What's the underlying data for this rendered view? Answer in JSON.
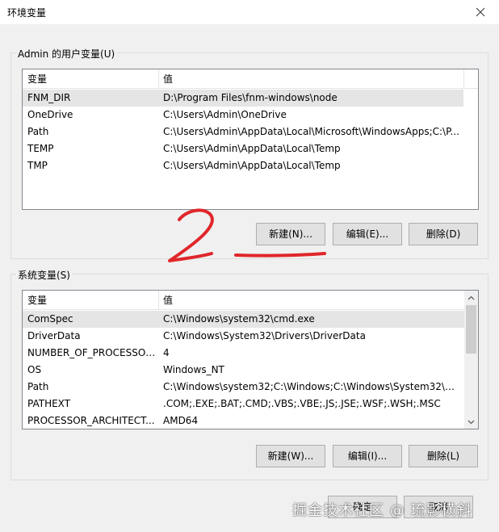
{
  "window": {
    "title": "环境变量"
  },
  "user_vars": {
    "group_label": "Admin 的用户变量(U)",
    "columns": [
      "变量",
      "值"
    ],
    "rows": [
      {
        "name": "FNM_DIR",
        "value": "D:\\Program Files\\fnm-windows\\node"
      },
      {
        "name": "OneDrive",
        "value": "C:\\Users\\Admin\\OneDrive"
      },
      {
        "name": "Path",
        "value": "C:\\Users\\Admin\\AppData\\Local\\Microsoft\\WindowsApps;C:\\P..."
      },
      {
        "name": "TEMP",
        "value": "C:\\Users\\Admin\\AppData\\Local\\Temp"
      },
      {
        "name": "TMP",
        "value": "C:\\Users\\Admin\\AppData\\Local\\Temp"
      }
    ],
    "buttons": {
      "new": "新建(N)...",
      "edit": "编辑(E)...",
      "delete": "删除(D)"
    }
  },
  "system_vars": {
    "group_label": "系统变量(S)",
    "columns": [
      "变量",
      "值"
    ],
    "rows": [
      {
        "name": "ComSpec",
        "value": "C:\\Windows\\system32\\cmd.exe"
      },
      {
        "name": "DriverData",
        "value": "C:\\Windows\\System32\\Drivers\\DriverData"
      },
      {
        "name": "NUMBER_OF_PROCESSORS",
        "value": "4"
      },
      {
        "name": "OS",
        "value": "Windows_NT"
      },
      {
        "name": "Path",
        "value": "C:\\Windows\\system32;C:\\Windows;C:\\Windows\\System32\\Wb..."
      },
      {
        "name": "PATHEXT",
        "value": ".COM;.EXE;.BAT;.CMD;.VBS;.VBE;.JS;.JSE;.WSF;.WSH;.MSC"
      },
      {
        "name": "PROCESSOR_ARCHITECT...",
        "value": "AMD64"
      }
    ],
    "buttons": {
      "new": "新建(W)...",
      "edit": "编辑(I)...",
      "delete": "删除(L)"
    }
  },
  "footer": {
    "ok": "确定",
    "cancel": "取消"
  },
  "annotation": {
    "text": "2",
    "color": "#e0262a"
  },
  "watermark": "掘金技术社区 @ 琉影横斜",
  "colors": {
    "selected_row": "#e5e5e5",
    "list_border": "#828790",
    "button_bg": "#e1e1e1"
  },
  "icons": [
    "close-icon",
    "scroll-up-icon",
    "scroll-down-icon"
  ]
}
